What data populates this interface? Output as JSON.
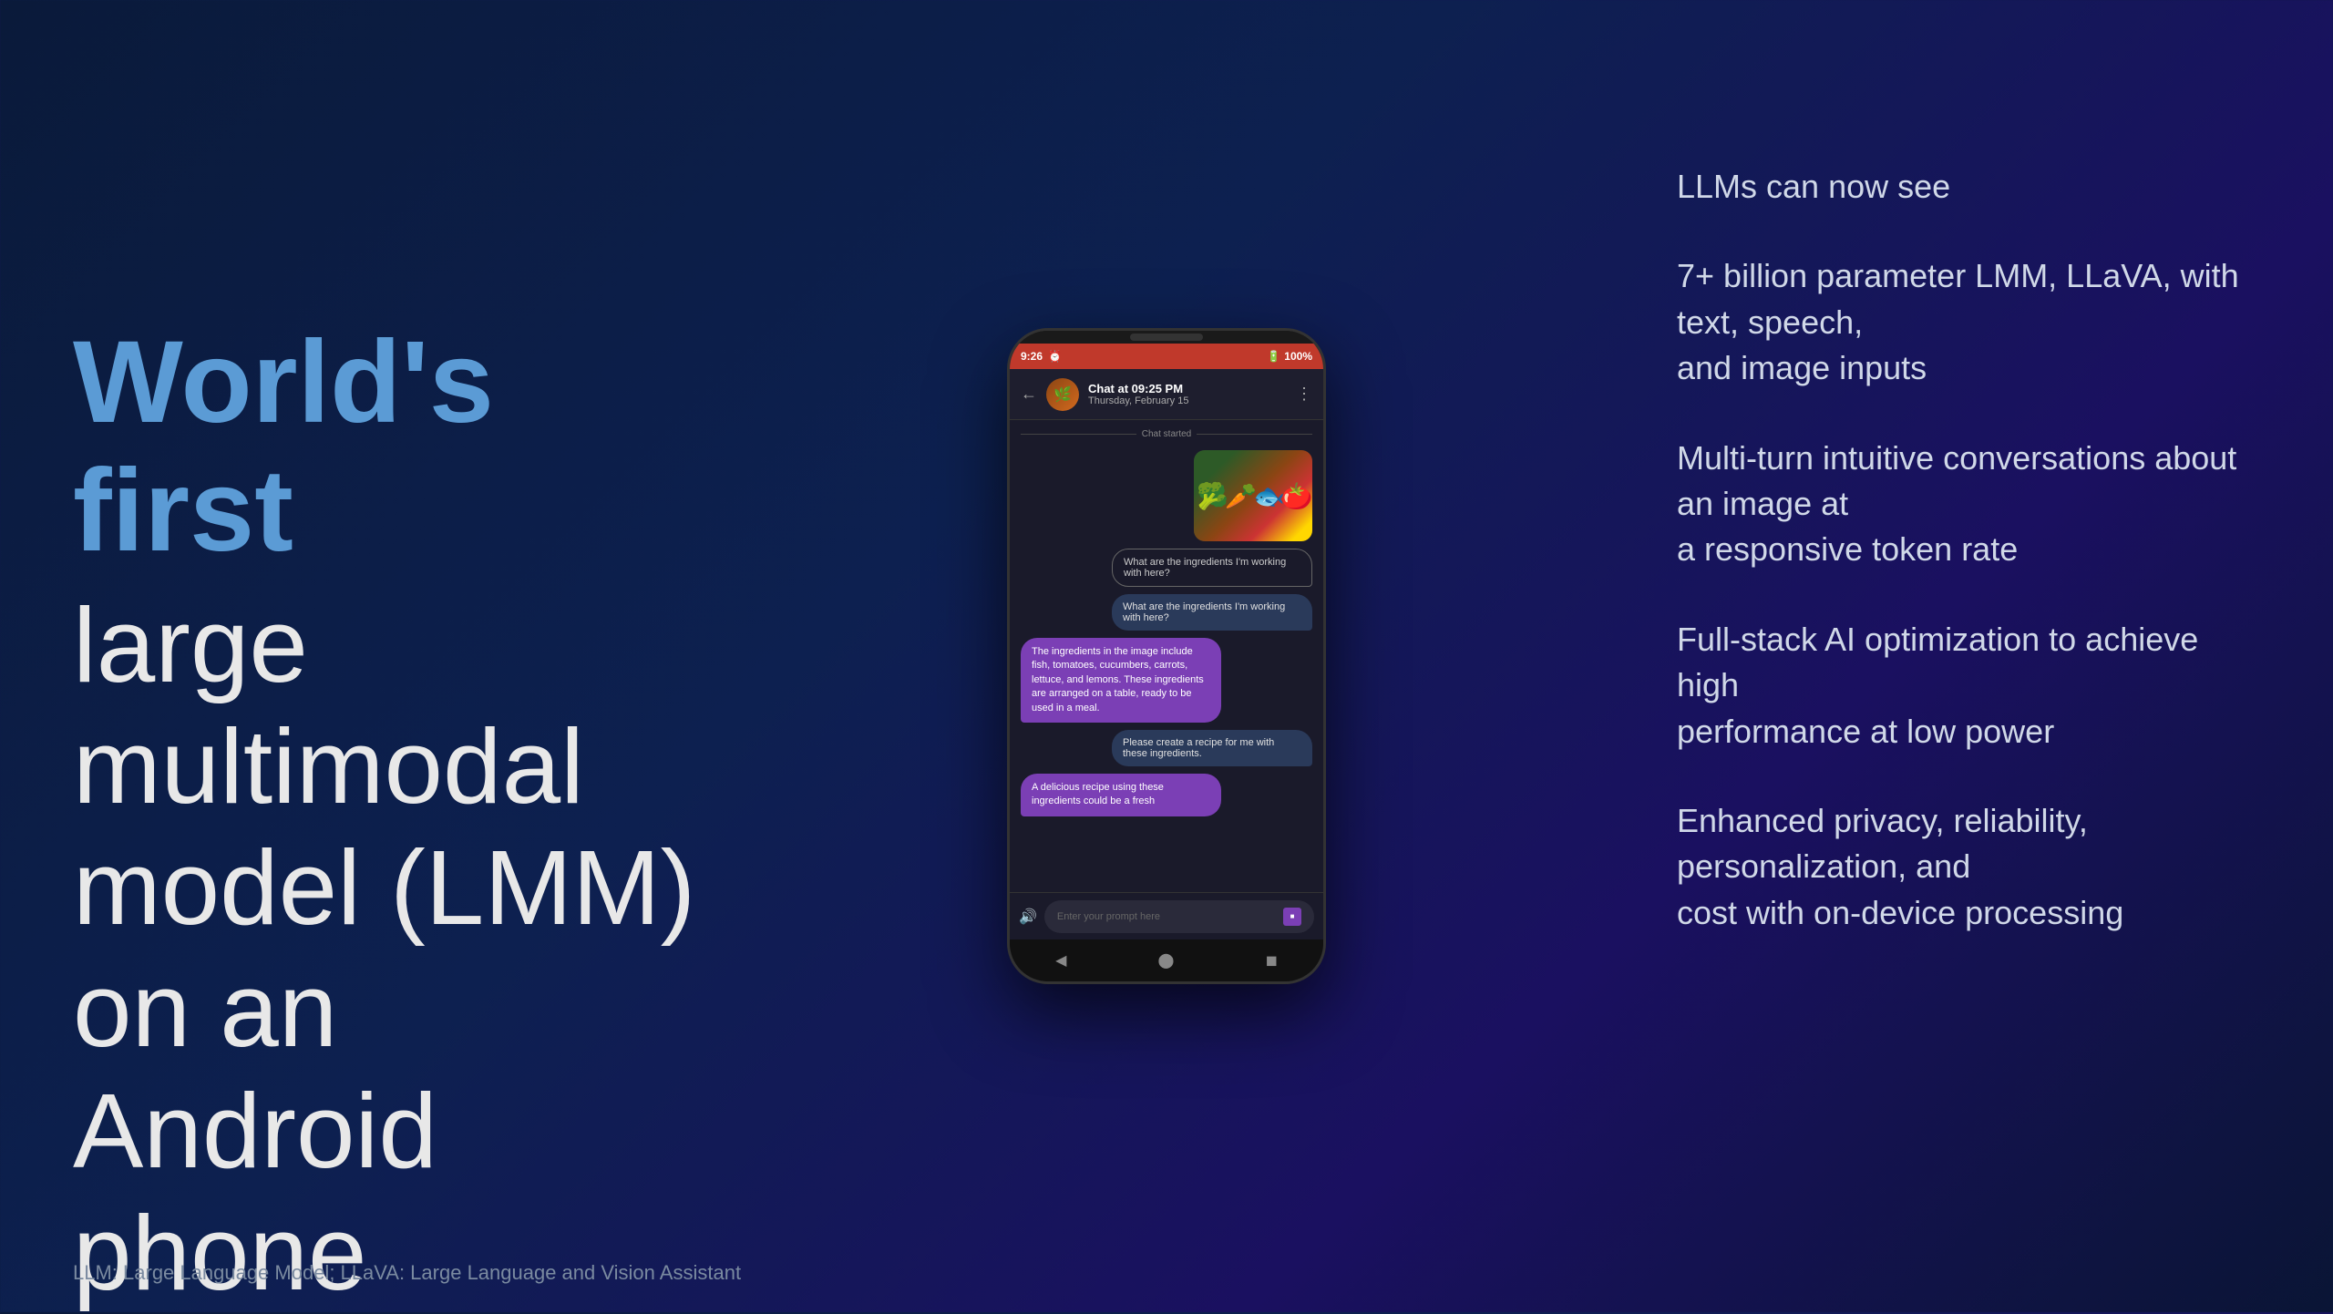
{
  "left": {
    "headline_blue": "World's first",
    "headline_white": "large multimodal\nmodel (LMM)\non an Android phone"
  },
  "phone": {
    "status_bar": {
      "time": "9:26",
      "battery": "100%"
    },
    "chat_header": {
      "title": "Chat at 09:25 PM",
      "subtitle": "Thursday, February 15"
    },
    "chat_started_label": "Chat started",
    "messages": [
      {
        "type": "bubble_right_outline",
        "text": "What are the ingredients I'm working with here?"
      },
      {
        "type": "bubble_right",
        "text": "What are the ingredients I'm working with here?"
      },
      {
        "type": "bubble_left",
        "text": "The ingredients in the image include fish, tomatoes, cucumbers, carrots, lettuce, and lemons. These ingredients are arranged on a table, ready to be used in a meal."
      },
      {
        "type": "bubble_right",
        "text": "Please create a recipe for me with these ingredients."
      },
      {
        "type": "bubble_left",
        "text": "A delicious recipe using these ingredients could be a fresh"
      }
    ],
    "input_placeholder": "Enter your prompt here"
  },
  "right": {
    "features": [
      {
        "text": "LLMs can now see"
      },
      {
        "text": "7+ billion parameter LMM, LLaVA, with text, speech,\nand image inputs"
      },
      {
        "text": "Multi-turn intuitive conversations about an image at\na responsive token rate"
      },
      {
        "text": "Full-stack AI optimization to achieve high\nperformance at low power"
      },
      {
        "text": "Enhanced privacy, reliability, personalization, and\ncost with on-device processing"
      }
    ]
  },
  "footer": {
    "text": "LLM: Large Language Model; LLaVA: Large Language and Vision Assistant"
  }
}
